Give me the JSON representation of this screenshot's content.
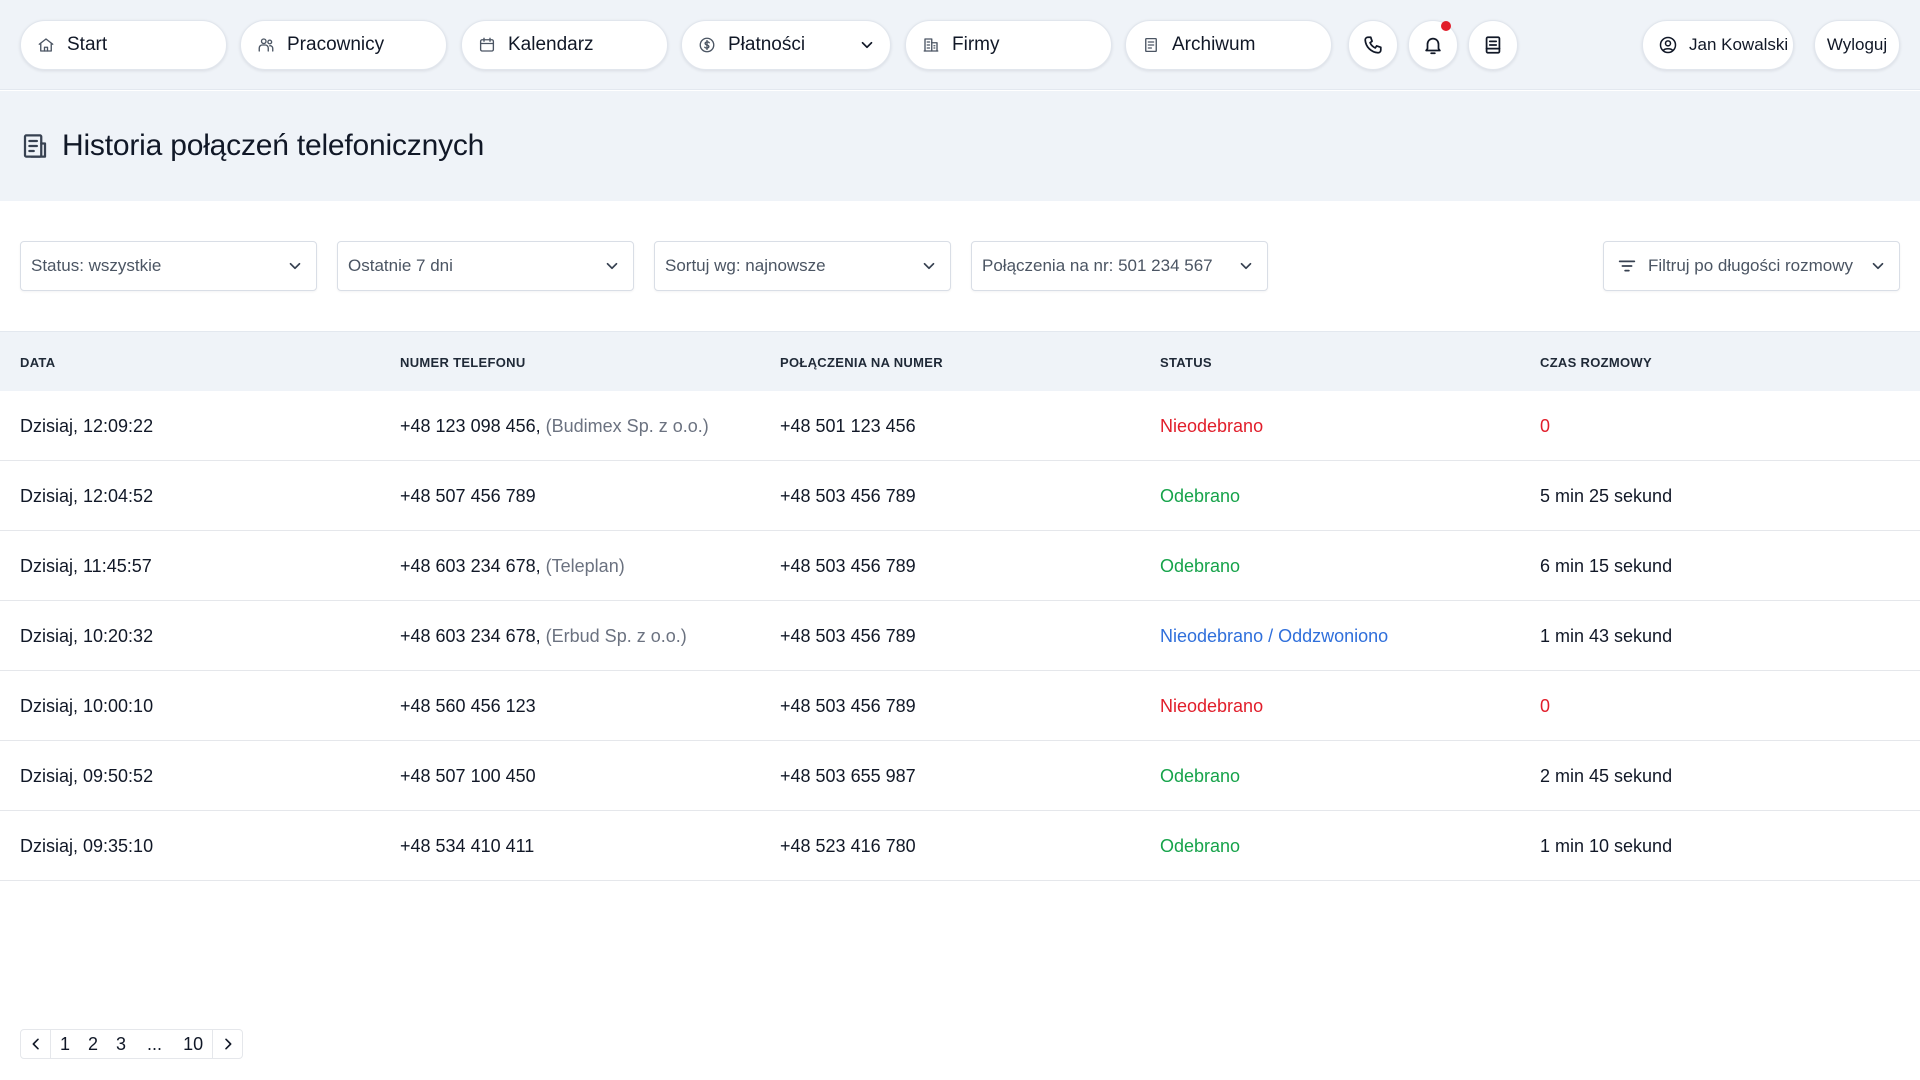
{
  "nav": {
    "items": [
      {
        "label": "Start",
        "icon": "home-icon"
      },
      {
        "label": "Pracownicy",
        "icon": "people-icon"
      },
      {
        "label": "Kalendarz",
        "icon": "calendar-icon"
      },
      {
        "label": "Płatności",
        "icon": "dollar-circle-icon"
      },
      {
        "label": "Firmy",
        "icon": "building-icon"
      },
      {
        "label": "Archiwum",
        "icon": "archive-icon"
      }
    ],
    "user_name": "Jan Kowalski",
    "logout_label": "Wyloguj",
    "notification_color": "#e11d2a"
  },
  "page": {
    "title": "Historia połączeń telefonicznych",
    "title_icon": "call-log-icon"
  },
  "filters": {
    "status": "Status: wszystkie",
    "period": "Ostatnie 7 dni",
    "sort": "Sortuj wg: najnowsze",
    "target_number": "Połączenia na nr: 501 234 567",
    "duration_filter": "Filtruj po długości rozmowy"
  },
  "table": {
    "columns": [
      "DATA",
      "NUMER TELEFONU",
      "POŁĄCZENIA NA NUMER",
      "STATUS",
      "CZAS ROZMOWY"
    ],
    "rows": [
      {
        "date": "Dzisiaj, 12:09:22",
        "phone": "+48 123 098 456,",
        "company": "(Budimex Sp. z o.o.)",
        "to": "+48 501 123 456",
        "status": "Nieodebrano",
        "status_type": "missed",
        "duration": "0"
      },
      {
        "date": "Dzisiaj, 12:04:52",
        "phone": "+48 507 456 789",
        "company": "",
        "to": "+48 503 456 789",
        "status": "Odebrano",
        "status_type": "answered",
        "duration": "5 min 25 sekund"
      },
      {
        "date": "Dzisiaj, 11:45:57",
        "phone": "+48 603 234 678,",
        "company": "(Teleplan)",
        "to": "+48 503 456 789",
        "status": "Odebrano",
        "status_type": "answered",
        "duration": "6 min 15 sekund"
      },
      {
        "date": "Dzisiaj, 10:20:32",
        "phone": "+48 603 234 678,",
        "company": "(Erbud Sp. z o.o.)",
        "to": "+48 503 456 789",
        "status": "Nieodebrano / Oddzwoniono",
        "status_type": "callback",
        "duration": "1 min 43 sekund"
      },
      {
        "date": "Dzisiaj, 10:00:10",
        "phone": "+48 560 456 123",
        "company": "",
        "to": "+48 503 456 789",
        "status": "Nieodebrano",
        "status_type": "missed",
        "duration": "0"
      },
      {
        "date": "Dzisiaj, 09:50:52",
        "phone": "+48 507 100 450",
        "company": "",
        "to": "+48 503 655 987",
        "status": "Odebrano",
        "status_type": "answered",
        "duration": "2 min 45 sekund"
      },
      {
        "date": "Dzisiaj, 09:35:10",
        "phone": "+48 534 410 411",
        "company": "",
        "to": "+48 523 416 780",
        "status": "Odebrano",
        "status_type": "answered",
        "duration": "1 min 10 sekund"
      }
    ]
  },
  "pagination": {
    "pages": [
      "1",
      "2",
      "3"
    ],
    "ellipsis": "...",
    "last": "10"
  },
  "colors": {
    "missed": "#e11d2a",
    "answered": "#16a34a",
    "callback": "#2f6fdb",
    "header_bg": "#eff3f8"
  }
}
